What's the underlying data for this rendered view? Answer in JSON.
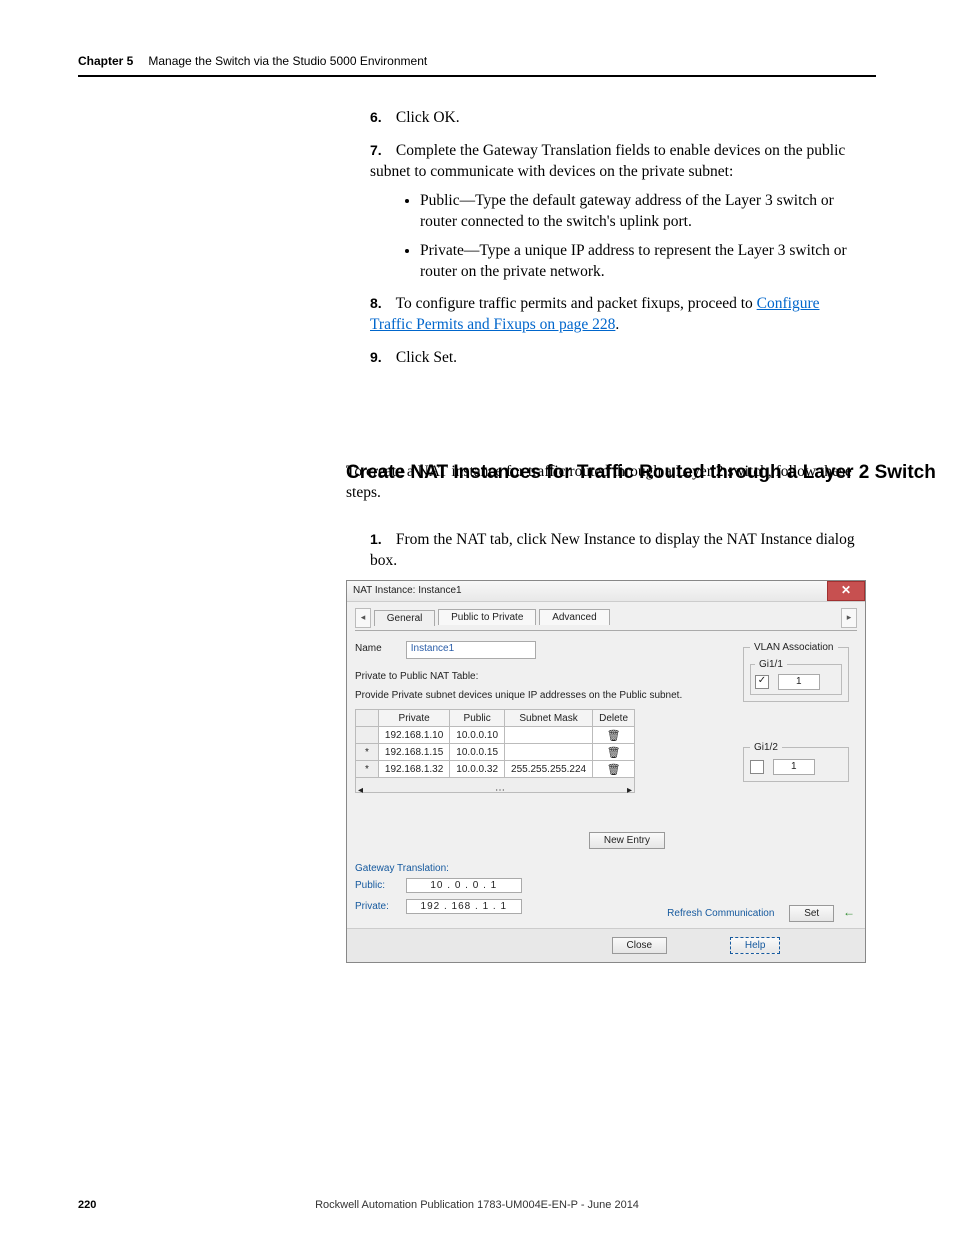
{
  "header": {
    "chapter": "Chapter 5",
    "title": "Manage the Switch via the Studio 5000 Environment"
  },
  "steps_top": {
    "n6": "6.",
    "t6": "Click OK.",
    "n7": "7.",
    "t7": "Complete the Gateway Translation fields to enable devices on the public subnet to communicate with devices on the private subnet:",
    "b7a": "Public—Type the default gateway address of the Layer 3 switch or router connected to the switch's uplink port.",
    "b7b": "Private—Type a unique IP address to represent the Layer 3 switch or router on the private network.",
    "n8": "8.",
    "t8a": "To configure traffic permits and packet fixups, proceed to ",
    "t8link": "Configure Traffic Permits and Fixups on page 228",
    "t8b": ".",
    "n9": "9.",
    "t9": "Click Set."
  },
  "section": {
    "heading": "Create NAT Instances for Traffic Routed through a Layer 2 Switch",
    "intro": "To create a NAT instance for traffic routed through a Layer 2 switch, follow these steps.",
    "n1": "1.",
    "t1": "From the NAT tab, click New Instance to display the NAT Instance dialog box."
  },
  "dialog": {
    "title": "NAT Instance: Instance1",
    "tabs": {
      "general": "General",
      "p2p": "Public to Private",
      "adv": "Advanced"
    },
    "name_label": "Name",
    "name_value": "Instance1",
    "subhead": "Private to Public NAT Table:",
    "hint": "Provide Private subnet devices unique IP addresses on the Public subnet.",
    "cols": {
      "private": "Private",
      "public": "Public",
      "mask": "Subnet Mask",
      "del": "Delete"
    },
    "rows": [
      {
        "private": "192.168.1.10",
        "public": "10.0.0.10",
        "mask": ""
      },
      {
        "private": "192.168.1.15",
        "public": "10.0.0.15",
        "mask": ""
      },
      {
        "private": "192.168.1.32",
        "public": "10.0.0.32",
        "mask": "255.255.255.224"
      }
    ],
    "new_entry": "New Entry",
    "gateway_label": "Gateway Translation:",
    "gw_public_label": "Public:",
    "gw_public_value": "10  .  0  .  0  .  1",
    "gw_private_label": "Private:",
    "gw_private_value": "192  . 168  .  1  .  1",
    "vlan_title": "VLAN Association",
    "gi11_label": "Gi1/1",
    "gi11_checked": "✓",
    "gi11_val": "1",
    "gi12_label": "Gi1/2",
    "gi12_val": "1",
    "refresh": "Refresh Communication",
    "set": "Set",
    "close": "Close",
    "help": "Help"
  },
  "footer": {
    "page": "220",
    "publication": "Rockwell Automation Publication 1783-UM004E-EN-P - June 2014"
  }
}
